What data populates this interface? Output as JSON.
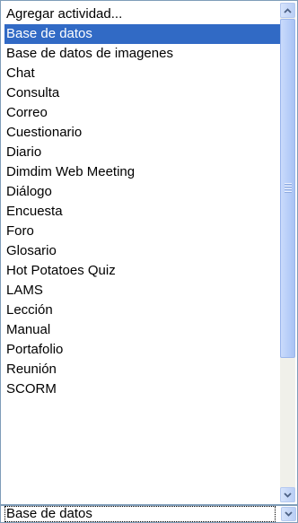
{
  "dropdown": {
    "items": [
      {
        "label": "Agregar actividad..."
      },
      {
        "label": "Base de datos"
      },
      {
        "label": "Base de datos de imagenes"
      },
      {
        "label": "Chat"
      },
      {
        "label": "Consulta"
      },
      {
        "label": "Correo"
      },
      {
        "label": "Cuestionario"
      },
      {
        "label": "Diario"
      },
      {
        "label": "Dimdim Web Meeting"
      },
      {
        "label": "Diálogo"
      },
      {
        "label": "Encuesta"
      },
      {
        "label": "Foro"
      },
      {
        "label": "Glosario"
      },
      {
        "label": "Hot Potatoes Quiz"
      },
      {
        "label": "LAMS"
      },
      {
        "label": "Lección"
      },
      {
        "label": "Manual"
      },
      {
        "label": "Portafolio"
      },
      {
        "label": "Reunión"
      },
      {
        "label": "SCORM"
      }
    ],
    "highlighted_index": 1
  },
  "select": {
    "value": "Base de datos"
  },
  "icons": {
    "scroll_up": "chevron-up-icon",
    "scroll_down": "chevron-down-icon",
    "select_arrow": "chevron-down-icon"
  },
  "colors": {
    "highlight": "#316ac5",
    "border": "#7f9db9",
    "scrollbar": "#b9cef5"
  }
}
